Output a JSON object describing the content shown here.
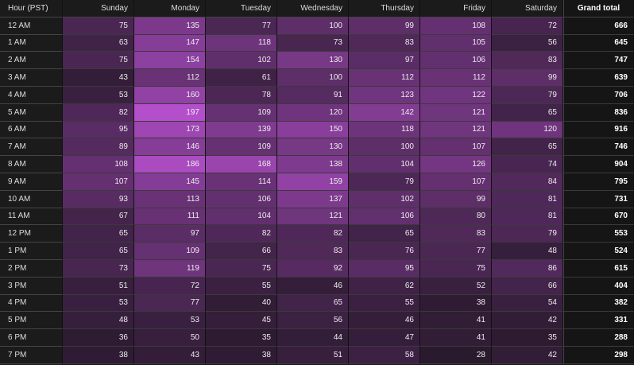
{
  "chart_data": {
    "type": "heatmap",
    "row_header": "Hour (PST)",
    "columns": [
      "Sunday",
      "Monday",
      "Tuesday",
      "Wednesday",
      "Thursday",
      "Friday",
      "Saturday"
    ],
    "total_header": "Grand total",
    "rows": [
      "12 AM",
      "1 AM",
      "2 AM",
      "3 AM",
      "4 AM",
      "5 AM",
      "6 AM",
      "7 AM",
      "8 AM",
      "9 AM",
      "10 AM",
      "11 AM",
      "12 PM",
      "1 PM",
      "2 PM",
      "3 PM",
      "4 PM",
      "5 PM",
      "6 PM",
      "7 PM"
    ],
    "values": [
      [
        75,
        135,
        77,
        100,
        99,
        108,
        72
      ],
      [
        63,
        147,
        118,
        73,
        83,
        105,
        56
      ],
      [
        75,
        154,
        102,
        130,
        97,
        106,
        83
      ],
      [
        43,
        112,
        61,
        100,
        112,
        112,
        99
      ],
      [
        53,
        160,
        78,
        91,
        123,
        122,
        79
      ],
      [
        82,
        197,
        109,
        120,
        142,
        121,
        65
      ],
      [
        95,
        173,
        139,
        150,
        118,
        121,
        120
      ],
      [
        89,
        146,
        109,
        130,
        100,
        107,
        65
      ],
      [
        108,
        186,
        168,
        138,
        104,
        126,
        74
      ],
      [
        107,
        145,
        114,
        159,
        79,
        107,
        84
      ],
      [
        93,
        113,
        106,
        137,
        102,
        99,
        81
      ],
      [
        67,
        111,
        104,
        121,
        106,
        80,
        81
      ],
      [
        65,
        97,
        82,
        82,
        65,
        83,
        79
      ],
      [
        65,
        109,
        66,
        83,
        76,
        77,
        48
      ],
      [
        73,
        119,
        75,
        92,
        95,
        75,
        86
      ],
      [
        51,
        72,
        55,
        46,
        62,
        52,
        66
      ],
      [
        53,
        77,
        40,
        65,
        55,
        38,
        54
      ],
      [
        48,
        53,
        45,
        56,
        46,
        41,
        42
      ],
      [
        36,
        50,
        35,
        44,
        47,
        41,
        35
      ],
      [
        38,
        43,
        38,
        51,
        58,
        28,
        42
      ]
    ],
    "totals": [
      666,
      645,
      747,
      639,
      706,
      836,
      916,
      746,
      904,
      795,
      731,
      670,
      553,
      524,
      615,
      404,
      382,
      331,
      288,
      298
    ],
    "color_min": "#2a1a2e",
    "color_max": "#b44fcc"
  }
}
